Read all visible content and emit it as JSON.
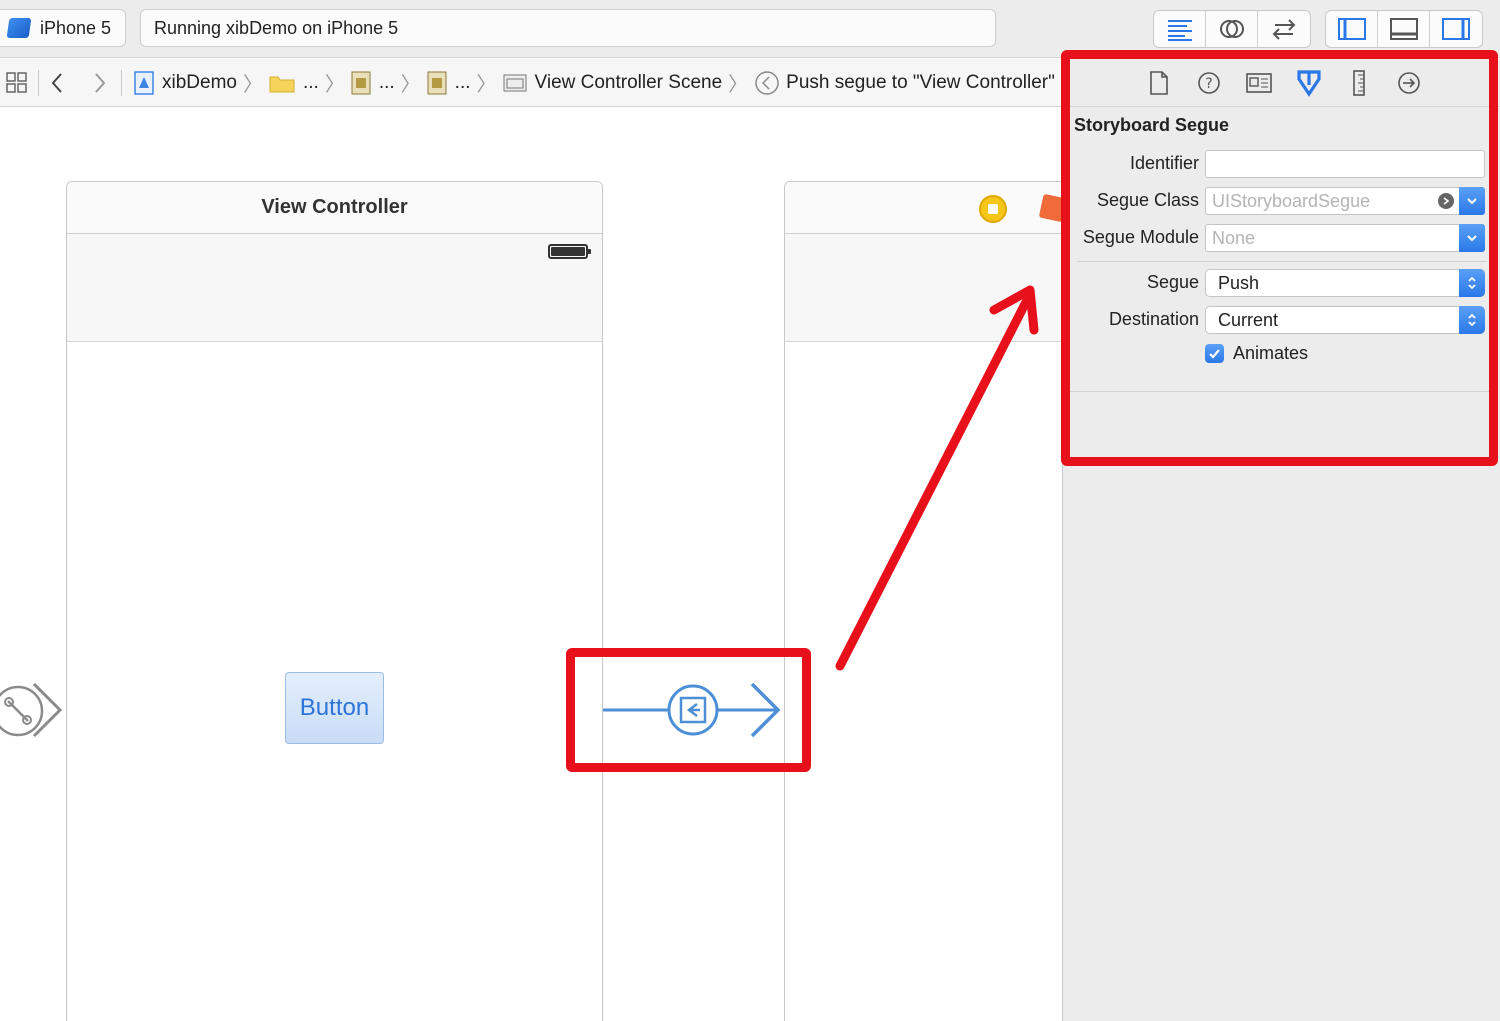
{
  "toolbar": {
    "scheme_device": "iPhone 5",
    "activity_status": "Running xibDemo on iPhone 5"
  },
  "jumpbar": {
    "items": [
      {
        "label": "xibDemo"
      },
      {
        "label": "..."
      },
      {
        "label": "..."
      },
      {
        "label": "..."
      },
      {
        "label": "View Controller Scene"
      },
      {
        "label": "Push segue to \"View Controller\""
      }
    ]
  },
  "canvas": {
    "scene1_title": "View Controller",
    "button_label": "Button"
  },
  "inspector": {
    "section_title": "Storyboard Segue",
    "identifier_label": "Identifier",
    "identifier_value": "",
    "segue_class_label": "Segue Class",
    "segue_class_placeholder": "UIStoryboardSegue",
    "segue_module_label": "Segue Module",
    "segue_module_placeholder": "None",
    "segue_label": "Segue",
    "segue_value": "Push",
    "destination_label": "Destination",
    "destination_value": "Current",
    "animates_label": "Animates",
    "animates_checked": true
  },
  "colors": {
    "annotation_red": "#e8101a",
    "accent_blue": "#2a78e8",
    "segue_blue": "#4d8fd6"
  }
}
